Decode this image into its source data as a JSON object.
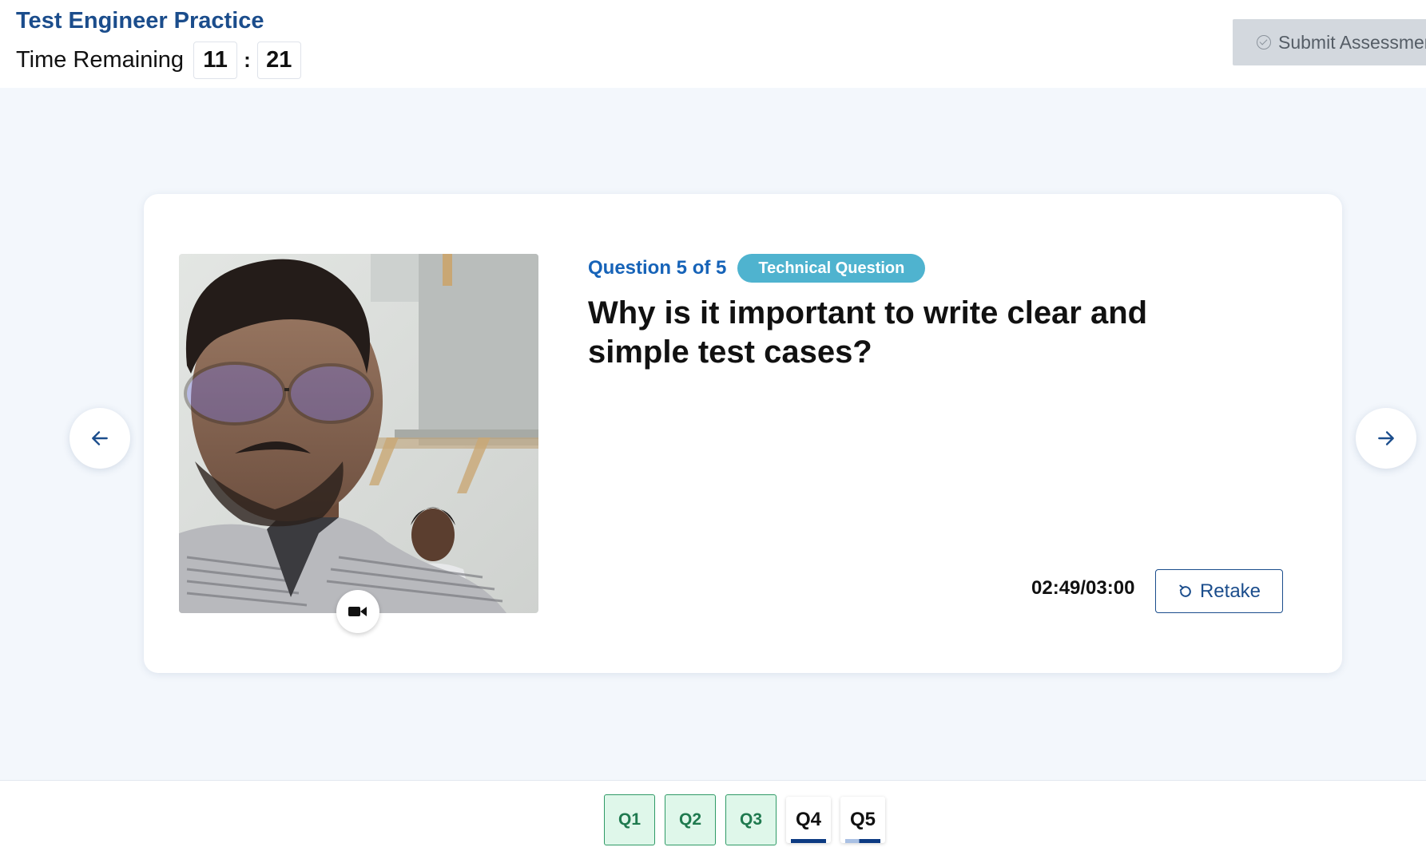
{
  "header": {
    "title": "Test Engineer Practice",
    "timer_label": "Time Remaining",
    "timer_minutes": "11",
    "timer_separator": ":",
    "timer_seconds": "21",
    "submit_label": "Submit Assessment"
  },
  "question": {
    "number_label": "Question 5 of 5",
    "type_badge": "Technical Question",
    "text": "Why is it important to write clear and simple test cases?",
    "answer_time": "02:49/03:00",
    "retake_label": "Retake"
  },
  "footer": {
    "tabs": [
      {
        "label": "Q1",
        "state": "answered"
      },
      {
        "label": "Q2",
        "state": "answered"
      },
      {
        "label": "Q3",
        "state": "answered"
      },
      {
        "label": "Q4",
        "state": "recorded"
      },
      {
        "label": "Q5",
        "state": "current"
      }
    ]
  },
  "colors": {
    "brand": "#1b4d8c",
    "accent": "#1663b8",
    "badge": "#4fb3cf",
    "answered_bg": "#dff7ea",
    "answered_border": "#2f9a66",
    "background": "#f3f7fc"
  },
  "icons": {
    "submit": "check-circle-icon",
    "camera": "video-camera-icon",
    "retake": "refresh-icon",
    "prev": "arrow-left-icon",
    "next": "arrow-right-icon"
  }
}
